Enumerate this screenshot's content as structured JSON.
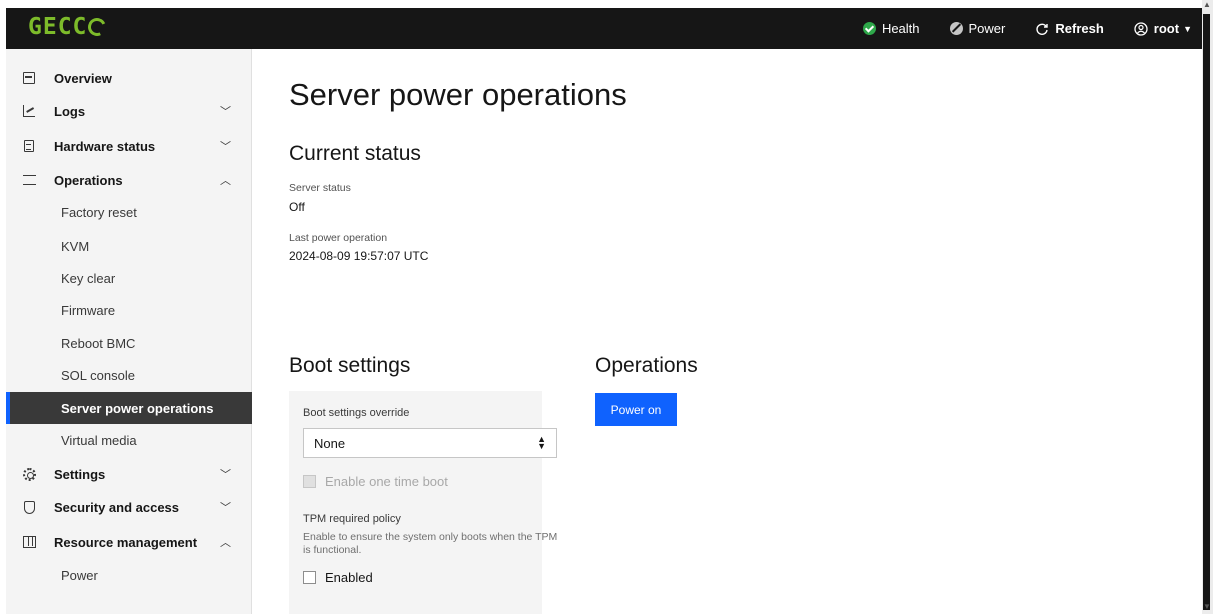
{
  "brand": {
    "logo_text": "GECC"
  },
  "topbar": {
    "health_label": "Health",
    "power_label": "Power",
    "refresh_label": "Refresh",
    "user_label": "root"
  },
  "sidebar": {
    "items": [
      {
        "label": "Overview"
      },
      {
        "label": "Logs"
      },
      {
        "label": "Hardware status"
      },
      {
        "label": "Operations"
      },
      {
        "label": "Settings"
      },
      {
        "label": "Security and access"
      },
      {
        "label": "Resource management"
      }
    ],
    "operations_children": [
      {
        "label": "Factory reset"
      },
      {
        "label": "KVM"
      },
      {
        "label": "Key clear"
      },
      {
        "label": "Firmware"
      },
      {
        "label": "Reboot BMC"
      },
      {
        "label": "SOL console"
      },
      {
        "label": "Server power operations"
      },
      {
        "label": "Virtual media"
      }
    ],
    "resource_children": [
      {
        "label": "Power"
      }
    ]
  },
  "main": {
    "title": "Server power operations",
    "current_status": {
      "heading": "Current status",
      "server_status_label": "Server status",
      "server_status_value": "Off",
      "last_op_label": "Last power operation",
      "last_op_value": "2024-08-09 19:57:07 UTC"
    },
    "boot_settings": {
      "heading": "Boot settings",
      "override_label": "Boot settings override",
      "override_value": "None",
      "one_time_boot_label": "Enable one time boot",
      "tpm_label": "TPM required policy",
      "tpm_help": "Enable to ensure the system only boots when the TPM is functional.",
      "tpm_enabled_label": "Enabled"
    },
    "operations": {
      "heading": "Operations",
      "power_on_label": "Power on"
    }
  },
  "colors": {
    "topbar_bg": "#161616",
    "brand_green": "#7dbb2a",
    "primary_blue": "#0f62fe",
    "health_green": "#2ea84a",
    "active_nav_bg": "#393939"
  }
}
